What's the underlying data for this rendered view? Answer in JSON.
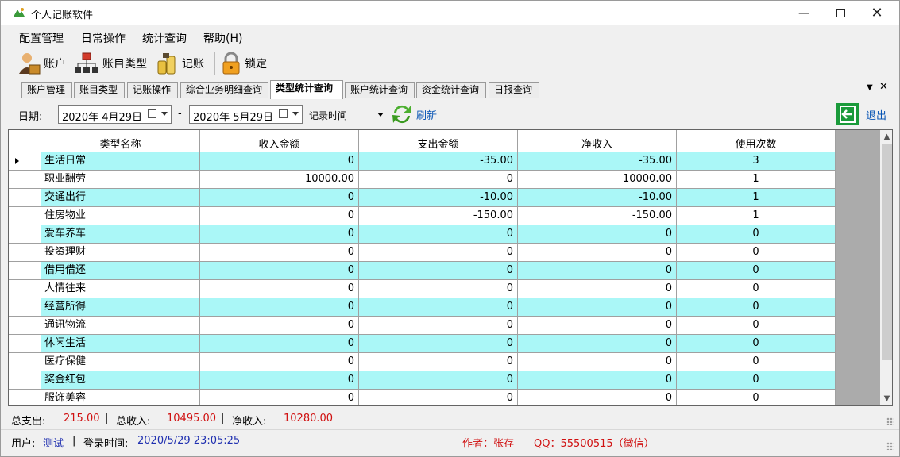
{
  "window": {
    "title": "个人记账软件"
  },
  "menu": [
    "配置管理",
    "日常操作",
    "统计查询",
    "帮助(H)"
  ],
  "toolbar": {
    "account": "账户",
    "account_type": "账目类型",
    "bookkeeping": "记账",
    "lock": "锁定"
  },
  "tabs": [
    "账户管理",
    "账目类型",
    "记账操作",
    "综合业务明细查询",
    "类型统计查询",
    "账户统计查询",
    "资金统计查询",
    "日报查询"
  ],
  "active_tab": "类型统计查询",
  "filter": {
    "date_label": "日期:",
    "date_from": "2020年  4月29日",
    "date_to": "2020年  5月29日",
    "separator": "-",
    "time_field": "记录时间",
    "refresh": "刷新",
    "exit": "退出"
  },
  "grid": {
    "columns": [
      "类型名称",
      "收入金额",
      "支出金额",
      "净收入",
      "使用次数"
    ],
    "rows": [
      [
        "生活日常",
        "0",
        "-35.00",
        "-35.00",
        "3"
      ],
      [
        "职业酬劳",
        "10000.00",
        "0",
        "10000.00",
        "1"
      ],
      [
        "交通出行",
        "0",
        "-10.00",
        "-10.00",
        "1"
      ],
      [
        "住房物业",
        "0",
        "-150.00",
        "-150.00",
        "1"
      ],
      [
        "爱车养车",
        "0",
        "0",
        "0",
        "0"
      ],
      [
        "投资理财",
        "0",
        "0",
        "0",
        "0"
      ],
      [
        "借用借还",
        "0",
        "0",
        "0",
        "0"
      ],
      [
        "人情往来",
        "0",
        "0",
        "0",
        "0"
      ],
      [
        "经营所得",
        "0",
        "0",
        "0",
        "0"
      ],
      [
        "通讯物流",
        "0",
        "0",
        "0",
        "0"
      ],
      [
        "休闲生活",
        "0",
        "0",
        "0",
        "0"
      ],
      [
        "医疗保健",
        "0",
        "0",
        "0",
        "0"
      ],
      [
        "奖金红包",
        "0",
        "0",
        "0",
        "0"
      ],
      [
        "服饰美容",
        "0",
        "0",
        "0",
        "0"
      ]
    ]
  },
  "summary": {
    "total_expense_label": "总支出:",
    "total_expense": "215.00",
    "total_income_label": "总收入:",
    "total_income": "10495.00",
    "net_income_label": "净收入:",
    "net_income": "10280.00",
    "sep": "|"
  },
  "status": {
    "user_label": "用户:",
    "user": "测试",
    "login_label": "登录时间:",
    "login_time": "2020/5/29 23:05:25",
    "author": "作者：张存",
    "qq": "QQ：55500515（微信）"
  },
  "colors": {
    "row_alt": "#aaf7f7",
    "accent_red": "#d01010",
    "link_blue": "#0a56b5"
  }
}
